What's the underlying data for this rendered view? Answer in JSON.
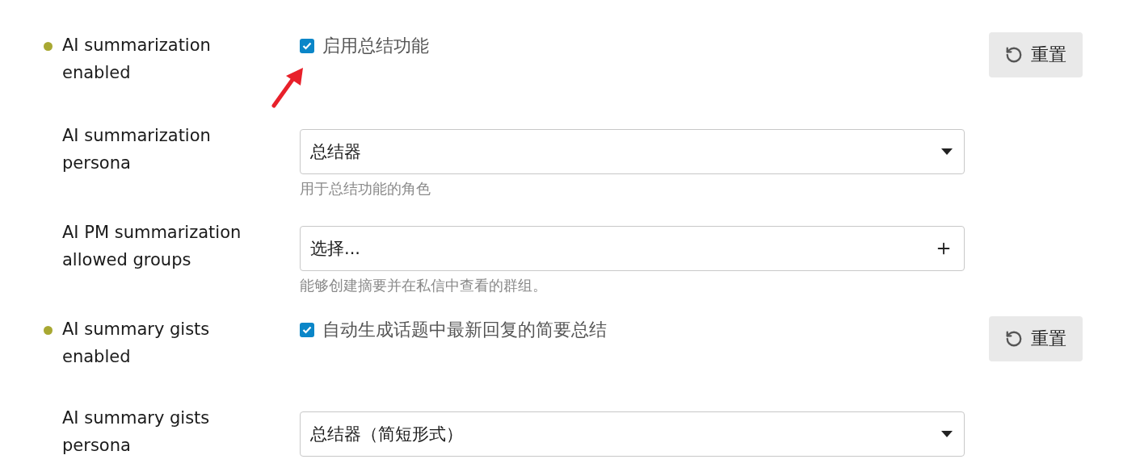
{
  "settings": [
    {
      "kind": "checkbox",
      "label": "AI summarization enabled",
      "modified": true,
      "checked": true,
      "text": "启用总结功能",
      "reset": "重置"
    },
    {
      "kind": "select",
      "label": "AI summarization persona",
      "modified": false,
      "value": "总结器",
      "description": "用于总结功能的角色"
    },
    {
      "kind": "multiselect",
      "label": "AI PM summarization allowed groups",
      "modified": false,
      "placeholder": "选择...",
      "description": "能够创建摘要并在私信中查看的群组。"
    },
    {
      "kind": "checkbox",
      "label": "AI summary gists enabled",
      "modified": true,
      "checked": true,
      "text": "自动生成话题中最新回复的简要总结",
      "reset": "重置"
    },
    {
      "kind": "select",
      "label": "AI summary gists persona",
      "modified": false,
      "value": "总结器（简短形式）"
    }
  ]
}
